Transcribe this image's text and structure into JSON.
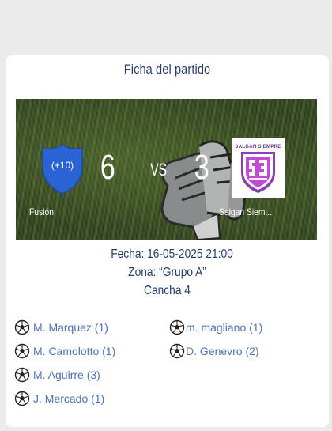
{
  "card": {
    "title": "Ficha del partido"
  },
  "match": {
    "home_team": {
      "name": "Fusión",
      "score": "6",
      "badge_text": "(+10)"
    },
    "away_team": {
      "name": "Salgan Siem...",
      "score": "3",
      "badge_text": "SALGAN SIEMPRE"
    },
    "vs_label": "VS"
  },
  "details": {
    "date": "Fecha: 16-05-2025 21:00",
    "zone": "Zona: “Grupo A”",
    "field": "Cancha 4"
  },
  "scorers": {
    "home": [
      {
        "name": "M. Marquez (1)",
        "icon": "soccer-ball-icon"
      },
      {
        "name": "M. Camolotto (1)",
        "icon": "soccer-ball-icon"
      },
      {
        "name": "M. Aguirre (3)",
        "icon": "soccer-ball-icon"
      },
      {
        "name": "J. Mercado (1)",
        "icon": "soccer-ball-icon"
      }
    ],
    "away": [
      {
        "name": "m. magliano (1)",
        "icon": "soccer-ball-icon"
      },
      {
        "name": "D. Genevro (2)",
        "icon": "soccer-ball-icon"
      }
    ]
  },
  "colors": {
    "title": "#263d6e",
    "scorer_text": "#4f73b5",
    "home_badge": "#2a63d4",
    "away_badge": "#8a3fb0",
    "background": "#ebebeb"
  }
}
